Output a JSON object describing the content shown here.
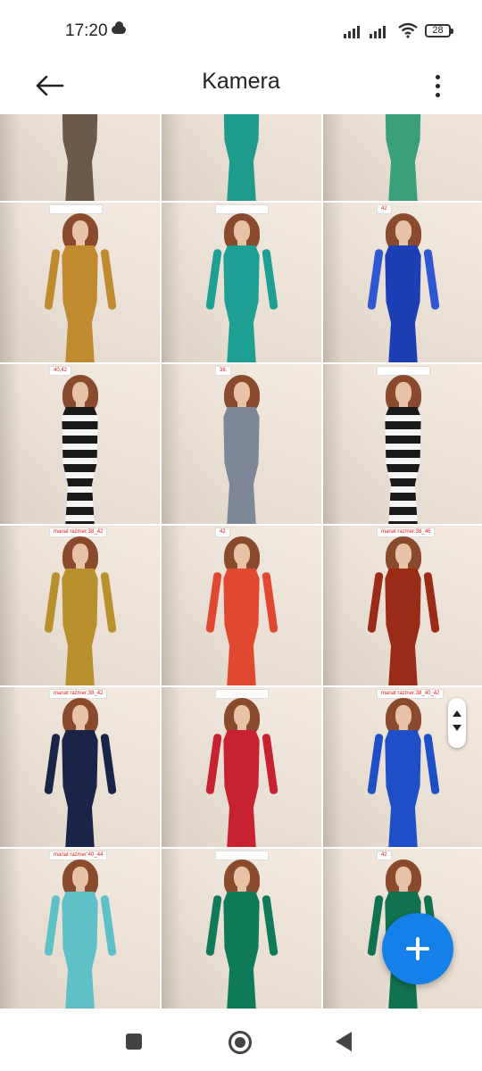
{
  "status_bar": {
    "time": "17:20",
    "battery": "28"
  },
  "app_bar": {
    "title": "Kamera"
  },
  "colors": {
    "accent": "#1580e8"
  },
  "icons": {
    "back": "arrow-left-icon",
    "more": "more-vertical-icon",
    "fab": "plus-icon",
    "scroll": "scroll-handle-icon",
    "nav": [
      "square-icon",
      "circle-home-icon",
      "triangle-back-icon"
    ]
  },
  "photos": [
    {
      "tag": "",
      "dress": "#6b5a4a",
      "sleeve": "none"
    },
    {
      "tag": "",
      "dress": "#1e9b8c",
      "sleeve": "none"
    },
    {
      "tag": "",
      "dress": "#3aa07a",
      "sleeve": "none"
    },
    {
      "tag": "",
      "dress": "#c08a2e",
      "sleeve": "#c08a2e"
    },
    {
      "tag": "",
      "dress": "#1d9f93",
      "sleeve": "#1d9f93"
    },
    {
      "tag": "42",
      "dress": "#1c3fb5",
      "sleeve": "#2e57d1"
    },
    {
      "tag": "40,42",
      "dress": "stripes",
      "sleeve": "none"
    },
    {
      "tag": "38,",
      "dress": "#7d8798",
      "sleeve": "none"
    },
    {
      "tag": "",
      "dress": "stripes",
      "sleeve": "none"
    },
    {
      "tag": "manat razmer:38_42",
      "dress": "#b8902e",
      "sleeve": "#b8902e"
    },
    {
      "tag": "42",
      "dress": "#e0492f",
      "sleeve": "#e0492f"
    },
    {
      "tag": "manat razmer:38_46",
      "dress": "#9a2b16",
      "sleeve": "#9a2b16"
    },
    {
      "tag": "manat razmer:38_42",
      "dress": "#1a2448",
      "sleeve": "#1a2448"
    },
    {
      "tag": "",
      "dress": "#c62230",
      "sleeve": "#c62230"
    },
    {
      "tag": "manat razmer:38_40_42",
      "dress": "#1f4fc7",
      "sleeve": "#1f4fc7"
    },
    {
      "tag": "manat razmer:40_44",
      "dress": "#5fc0c8",
      "sleeve": "#5fc0c8"
    },
    {
      "tag": "",
      "dress": "#0f7a58",
      "sleeve": "#0f7a58"
    },
    {
      "tag": "42",
      "dress": "#11724f",
      "sleeve": "#11724f"
    }
  ]
}
